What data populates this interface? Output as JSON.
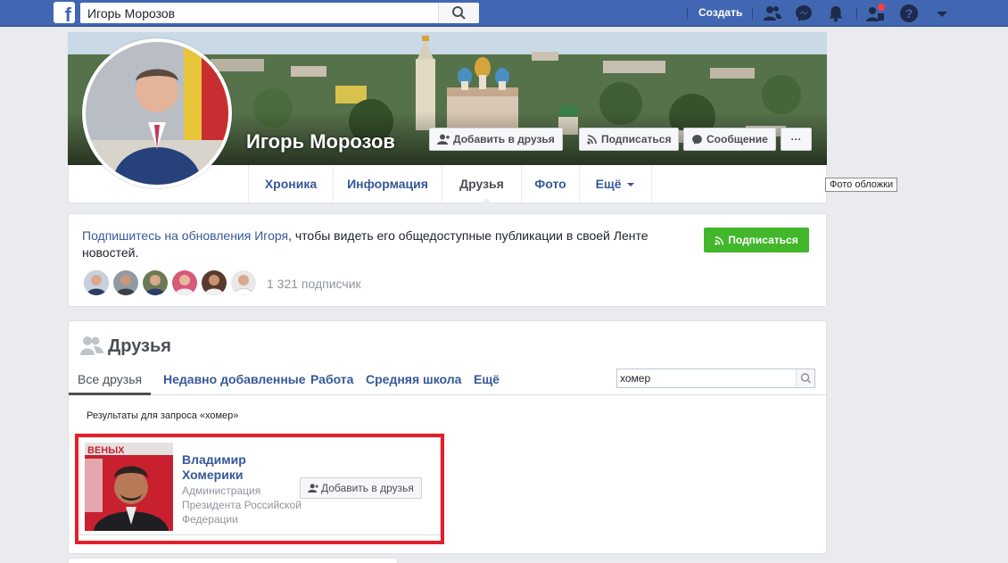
{
  "topbar": {
    "logo_letter": "f",
    "search_value": "Игорь Морозов",
    "create_label": "Создать",
    "icons": [
      "friends-icon",
      "messenger-icon",
      "notifications-icon",
      "friend-requests-icon",
      "help-icon",
      "chevron-down-icon"
    ],
    "accent_color": "#4267b2"
  },
  "profile": {
    "name": "Игорь Морозов",
    "add_friend_label": "Добавить в друзья",
    "follow_label": "Подписаться",
    "message_label": "Сообщение",
    "more_label": "···",
    "cover_tooltip": "Фото обложки",
    "tabs": [
      {
        "label": "Хроника"
      },
      {
        "label": "Информация"
      },
      {
        "label": "Друзья"
      },
      {
        "label": "Фото"
      },
      {
        "label": "Ещё"
      }
    ],
    "active_tab": "Друзья"
  },
  "follow_card": {
    "link_text": "Подпишитесь на обновления Игоря",
    "rest_text": ", чтобы видеть его общедоступные публикации в своей Ленте новостей.",
    "follow_button_label": "Подписаться",
    "followers_count": "1 321 подписчик",
    "green_color": "#42b72a"
  },
  "friends": {
    "title": "Друзья",
    "tabs": [
      {
        "label": "Все друзья"
      },
      {
        "label": "Недавно добавленные"
      },
      {
        "label": "Работа"
      },
      {
        "label": "Средняя школа"
      },
      {
        "label": "Ещё"
      }
    ],
    "search_value": "хомер",
    "results_label": "Результаты для запроса «хомер»",
    "result": {
      "name": "Владимир Хомерики",
      "description": "Администрация Президента Российской Федерации",
      "add_friend_label": "Добавить в друзья",
      "photo_backdrop_text": "ВЕНЬІХ"
    },
    "highlight_color": "#e3202a"
  }
}
